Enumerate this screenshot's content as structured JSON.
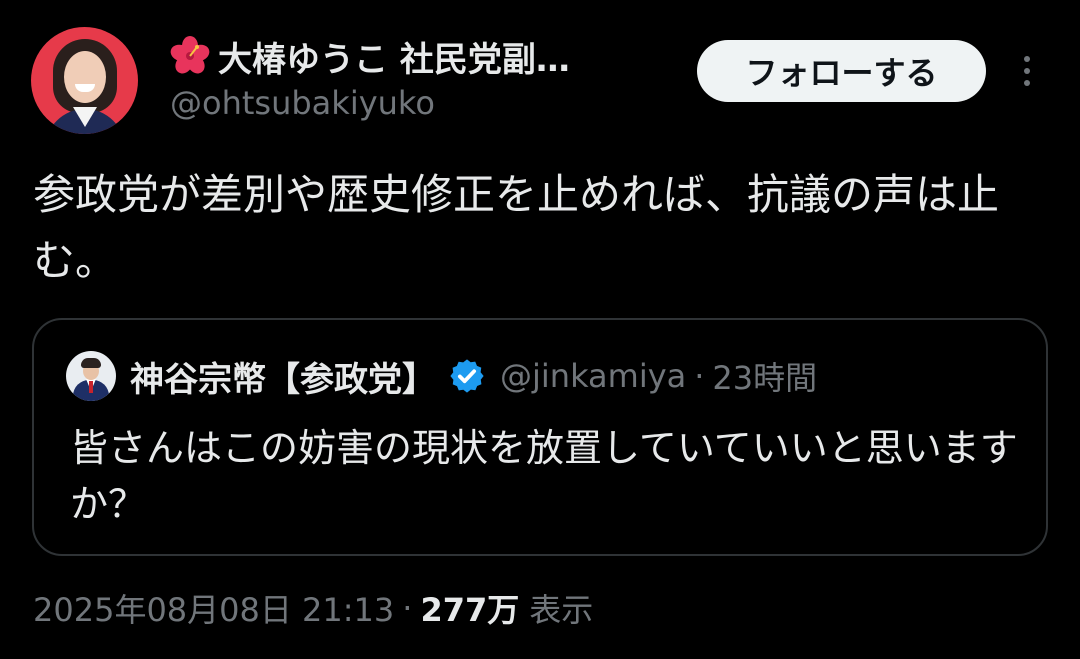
{
  "author": {
    "display_name": "大椿ゆうこ 社民党副…",
    "handle": "@ohtsubakiyuko",
    "name_emoji_icon": "hibiscus-icon"
  },
  "actions": {
    "follow_label": "フォローする",
    "more_icon": "more-vertical-icon"
  },
  "tweet": {
    "text": "参政党が差別や歴史修正を止めれば、抗議の声は止む。"
  },
  "quote": {
    "name": "神谷宗幣【参政党】",
    "verified_icon": "verified-badge-icon",
    "handle": "@jinkamiya",
    "separator": "·",
    "time": "23時間",
    "text": "皆さんはこの妨害の現状を放置していていいと思いますか？"
  },
  "meta": {
    "timestamp": "2025年08月08日 21:13",
    "separator": "·",
    "view_count": "277万",
    "view_label": "表示"
  },
  "colors": {
    "background": "#000000",
    "primary_text": "#e7e9ea",
    "secondary_text": "#71767b",
    "border": "#2f3336",
    "follow_button_bg": "#eff3f4",
    "verified_blue": "#1d9bf0",
    "avatar_bg": "#e63a4a"
  }
}
